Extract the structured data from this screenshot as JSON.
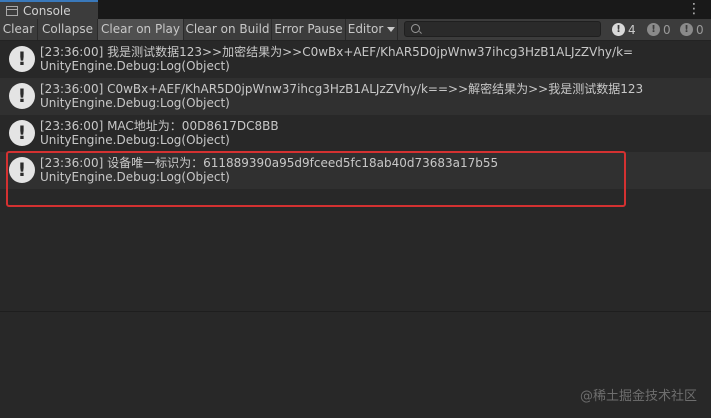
{
  "window": {
    "tab_label": "Console",
    "menu_glyph": "⋮"
  },
  "toolbar": {
    "buttons": [
      "Clear",
      "Collapse",
      "Clear on Play",
      "Clear on Build",
      "Error Pause",
      "Editor"
    ],
    "search_placeholder": "",
    "counts": {
      "log": "4",
      "warning": "0",
      "error": "0"
    },
    "count_icon_glyph": "!"
  },
  "entries": [
    {
      "line1": "[23:36:00] 我是测试数据123>>加密结果为>>C0wBx+AEF/KhAR5D0jpWnw37ihcg3HzB1ALJzZVhy/k=",
      "line2": "UnityEngine.Debug:Log(Object)"
    },
    {
      "line1": "[23:36:00] C0wBx+AEF/KhAR5D0jpWnw37ihcg3HzB1ALJzZVhy/k==>>解密结果为>>我是测试数据123",
      "line2": "UnityEngine.Debug:Log(Object)"
    },
    {
      "line1": "[23:36:00] MAC地址为：00D8617DC8BB",
      "line2": "UnityEngine.Debug:Log(Object)"
    },
    {
      "line1": "[23:36:00] 设备唯一标识为：611889390a95d9fceed5fc18ab40d73683a17b55",
      "line2": "UnityEngine.Debug:Log(Object)"
    }
  ],
  "entry_icon_glyph": "!",
  "watermark": "@稀土掘金技术社区"
}
